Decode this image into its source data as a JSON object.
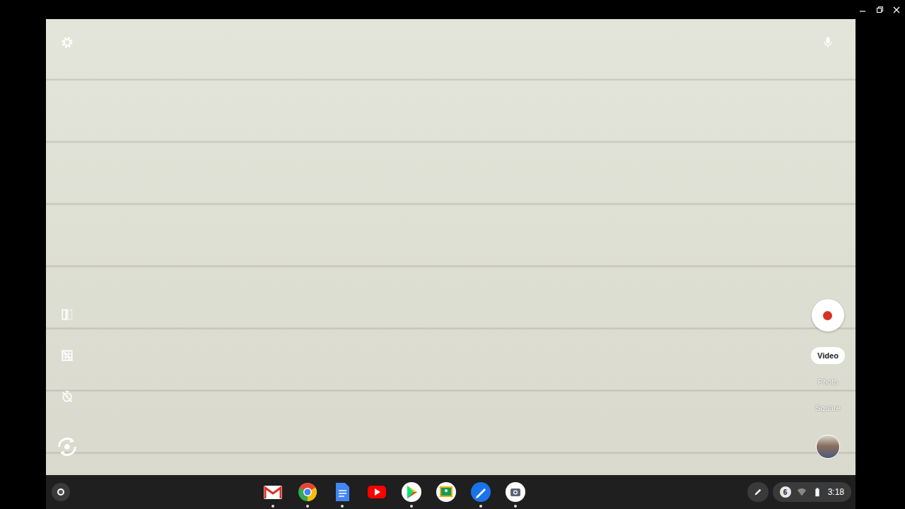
{
  "camera": {
    "modes": [
      {
        "label": "Video",
        "selected": true
      },
      {
        "label": "Photo",
        "selected": false
      },
      {
        "label": "Square",
        "selected": false
      }
    ],
    "timer_on": false
  },
  "shelf": {
    "apps": [
      {
        "kind": "gmail",
        "running": true
      },
      {
        "kind": "chrome",
        "running": true
      },
      {
        "kind": "docs",
        "running": true
      },
      {
        "kind": "youtube",
        "running": false
      },
      {
        "kind": "play",
        "running": true
      },
      {
        "kind": "classroom",
        "running": false
      },
      {
        "kind": "canvas",
        "running": true
      },
      {
        "kind": "camera",
        "running": true
      }
    ]
  },
  "status": {
    "notifications": "6",
    "time": "3:18"
  }
}
